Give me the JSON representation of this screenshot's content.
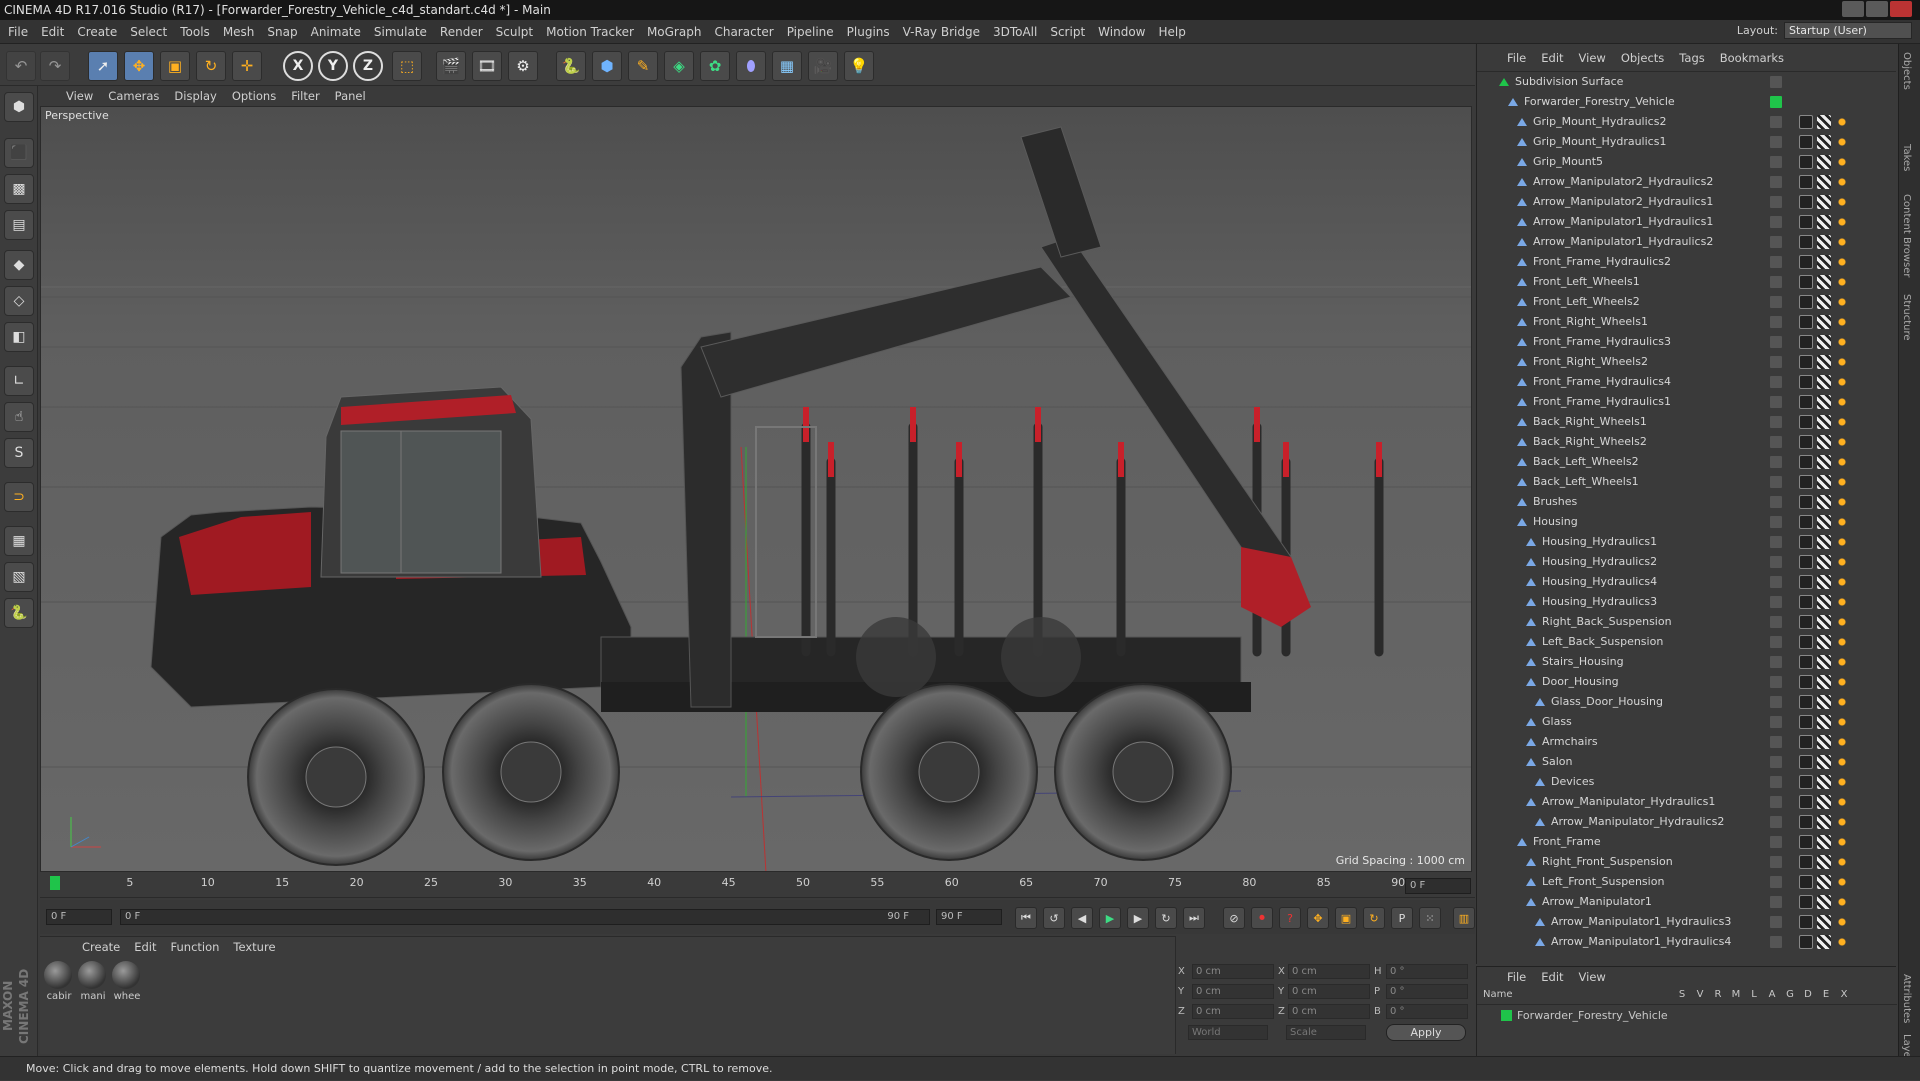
{
  "window": {
    "title": "CINEMA 4D R17.016 Studio (R17) - [Forwarder_Forestry_Vehicle_c4d_standart.c4d *] - Main"
  },
  "menubar": {
    "items": [
      "File",
      "Edit",
      "Create",
      "Select",
      "Tools",
      "Mesh",
      "Snap",
      "Animate",
      "Simulate",
      "Render",
      "Sculpt",
      "Motion Tracker",
      "MoGraph",
      "Character",
      "Pipeline",
      "Plugins",
      "V-Ray Bridge",
      "3DToAll",
      "Script",
      "Window",
      "Help"
    ]
  },
  "layout": {
    "label": "Layout:",
    "value": "Startup (User)"
  },
  "toolbar": {
    "x_label": "X",
    "y_label": "Y",
    "z_label": "Z"
  },
  "viewport": {
    "menu": [
      "View",
      "Cameras",
      "Display",
      "Options",
      "Filter",
      "Panel"
    ],
    "label": "Perspective",
    "grid_spacing": "Grid Spacing : 1000 cm"
  },
  "timeline": {
    "ticks": [
      "0",
      "5",
      "10",
      "15",
      "20",
      "25",
      "30",
      "35",
      "40",
      "45",
      "50",
      "55",
      "60",
      "65",
      "70",
      "75",
      "80",
      "85",
      "90"
    ],
    "frame_field": "0 F"
  },
  "transport": {
    "start": "0 F",
    "range_start": "0 F",
    "range_end": "90 F",
    "end": "90 F"
  },
  "materials": {
    "menu": [
      "Create",
      "Edit",
      "Function",
      "Texture"
    ],
    "items": [
      "cabir",
      "mani",
      "whee"
    ]
  },
  "coords": {
    "rows": [
      {
        "a": "X",
        "av": "0 cm",
        "b": "X",
        "bv": "0 cm",
        "c": "H",
        "cv": "0 °"
      },
      {
        "a": "Y",
        "av": "0 cm",
        "b": "Y",
        "bv": "0 cm",
        "c": "P",
        "cv": "0 °"
      },
      {
        "a": "Z",
        "av": "0 cm",
        "b": "Z",
        "bv": "0 cm",
        "c": "B",
        "cv": "0 °"
      }
    ],
    "world": "World",
    "scale": "Scale",
    "apply": "Apply"
  },
  "objects": {
    "menu": [
      "File",
      "Edit",
      "View",
      "Objects",
      "Tags",
      "Bookmarks"
    ],
    "rows": [
      {
        "name": "Subdivision Surface",
        "indent": 0
      },
      {
        "name": "Forwarder_Forestry_Vehicle",
        "indent": 1
      },
      {
        "name": "Grip_Mount_Hydraulics2",
        "indent": 2
      },
      {
        "name": "Grip_Mount_Hydraulics1",
        "indent": 2
      },
      {
        "name": "Grip_Mount5",
        "indent": 2
      },
      {
        "name": "Arrow_Manipulator2_Hydraulics2",
        "indent": 2
      },
      {
        "name": "Arrow_Manipulator2_Hydraulics1",
        "indent": 2
      },
      {
        "name": "Arrow_Manipulator1_Hydraulics1",
        "indent": 2
      },
      {
        "name": "Arrow_Manipulator1_Hydraulics2",
        "indent": 2
      },
      {
        "name": "Front_Frame_Hydraulics2",
        "indent": 2
      },
      {
        "name": "Front_Left_Wheels1",
        "indent": 2
      },
      {
        "name": "Front_Left_Wheels2",
        "indent": 2
      },
      {
        "name": "Front_Right_Wheels1",
        "indent": 2
      },
      {
        "name": "Front_Frame_Hydraulics3",
        "indent": 2
      },
      {
        "name": "Front_Right_Wheels2",
        "indent": 2
      },
      {
        "name": "Front_Frame_Hydraulics4",
        "indent": 2
      },
      {
        "name": "Front_Frame_Hydraulics1",
        "indent": 2
      },
      {
        "name": "Back_Right_Wheels1",
        "indent": 2
      },
      {
        "name": "Back_Right_Wheels2",
        "indent": 2
      },
      {
        "name": "Back_Left_Wheels2",
        "indent": 2
      },
      {
        "name": "Back_Left_Wheels1",
        "indent": 2
      },
      {
        "name": "Brushes",
        "indent": 2
      },
      {
        "name": "Housing",
        "indent": 2
      },
      {
        "name": "Housing_Hydraulics1",
        "indent": 3
      },
      {
        "name": "Housing_Hydraulics2",
        "indent": 3
      },
      {
        "name": "Housing_Hydraulics4",
        "indent": 3
      },
      {
        "name": "Housing_Hydraulics3",
        "indent": 3
      },
      {
        "name": "Right_Back_Suspension",
        "indent": 3
      },
      {
        "name": "Left_Back_Suspension",
        "indent": 3
      },
      {
        "name": "Stairs_Housing",
        "indent": 3
      },
      {
        "name": "Door_Housing",
        "indent": 3
      },
      {
        "name": "Glass_Door_Housing",
        "indent": 4
      },
      {
        "name": "Glass",
        "indent": 3
      },
      {
        "name": "Armchairs",
        "indent": 3
      },
      {
        "name": "Salon",
        "indent": 3
      },
      {
        "name": "Devices",
        "indent": 4
      },
      {
        "name": "Arrow_Manipulator_Hydraulics1",
        "indent": 3
      },
      {
        "name": "Arrow_Manipulator_Hydraulics2",
        "indent": 4
      },
      {
        "name": "Front_Frame",
        "indent": 2
      },
      {
        "name": "Right_Front_Suspension",
        "indent": 3
      },
      {
        "name": "Left_Front_Suspension",
        "indent": 3
      },
      {
        "name": "Arrow_Manipulator1",
        "indent": 3
      },
      {
        "name": "Arrow_Manipulator1_Hydraulics3",
        "indent": 4
      },
      {
        "name": "Arrow_Manipulator1_Hydraulics4",
        "indent": 4
      }
    ]
  },
  "layers": {
    "menu": [
      "File",
      "Edit",
      "View"
    ],
    "header_name": "Name",
    "header_cols": [
      "S",
      "V",
      "R",
      "M",
      "L",
      "A",
      "G",
      "D",
      "E",
      "X"
    ],
    "row": "Forwarder_Forestry_Vehicle"
  },
  "right_tabs": [
    "Objects",
    "Takes",
    "Content Browser",
    "Structure",
    "Attributes",
    "Layers"
  ],
  "brand": "MAXON CINEMA 4D",
  "status": "Move: Click and drag to move elements. Hold down SHIFT to quantize movement / add to the selection in point mode, CTRL to remove.",
  "colors": {
    "accent_red": "#c8202a",
    "viewport_bg": "#5d5d5d",
    "tree_icon": "#7aa8e6",
    "layer_green": "#1fc44a"
  }
}
